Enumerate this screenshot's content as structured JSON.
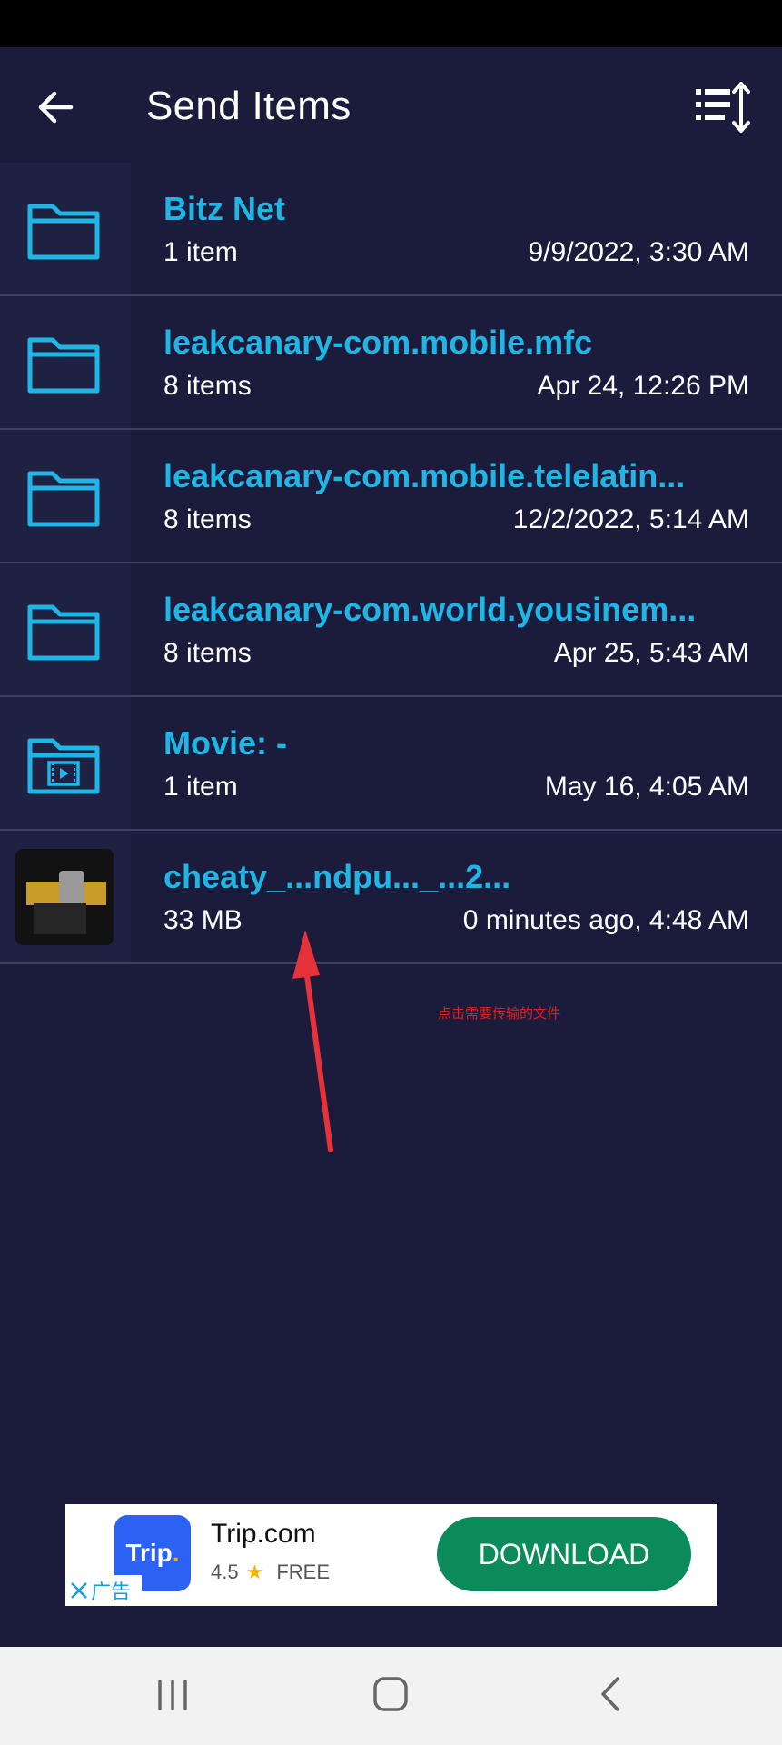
{
  "header": {
    "title": "Send Items"
  },
  "items": [
    {
      "name": "Bitz Net",
      "meta": "1 item",
      "date": "9/9/2022, 3:30 AM",
      "icon": "folder-icon"
    },
    {
      "name": "leakcanary-com.mobile.mfc",
      "meta": "8 items",
      "date": "Apr 24, 12:26 PM",
      "icon": "folder-icon"
    },
    {
      "name": "leakcanary-com.mobile.telelatin...",
      "meta": "8 items",
      "date": "12/2/2022, 5:14 AM",
      "icon": "folder-icon"
    },
    {
      "name": "leakcanary-com.world.yousinem...",
      "meta": "8 items",
      "date": "Apr 25, 5:43 AM",
      "icon": "folder-icon"
    },
    {
      "name": "Movie: -",
      "meta": "1 item",
      "date": "May 16, 4:05 AM",
      "icon": "video-folder-icon"
    },
    {
      "name": "cheaty_...ndpu..._...2...",
      "meta": "33 MB",
      "date": "0 minutes ago, 4:48 AM",
      "icon": "video-thumbnail"
    }
  ],
  "annotation": "点击需要传输的文件",
  "ad": {
    "logo_text": "Trip",
    "logo_dot": ".",
    "title": "Trip.com",
    "rating": "4.5",
    "price": "FREE",
    "cta": "DOWNLOAD",
    "close_label": "广告"
  },
  "colors": {
    "background": "#1b1c3c",
    "accent": "#1fb6e6",
    "divider": "#3d4063",
    "ad_button": "#0b8a5a"
  }
}
